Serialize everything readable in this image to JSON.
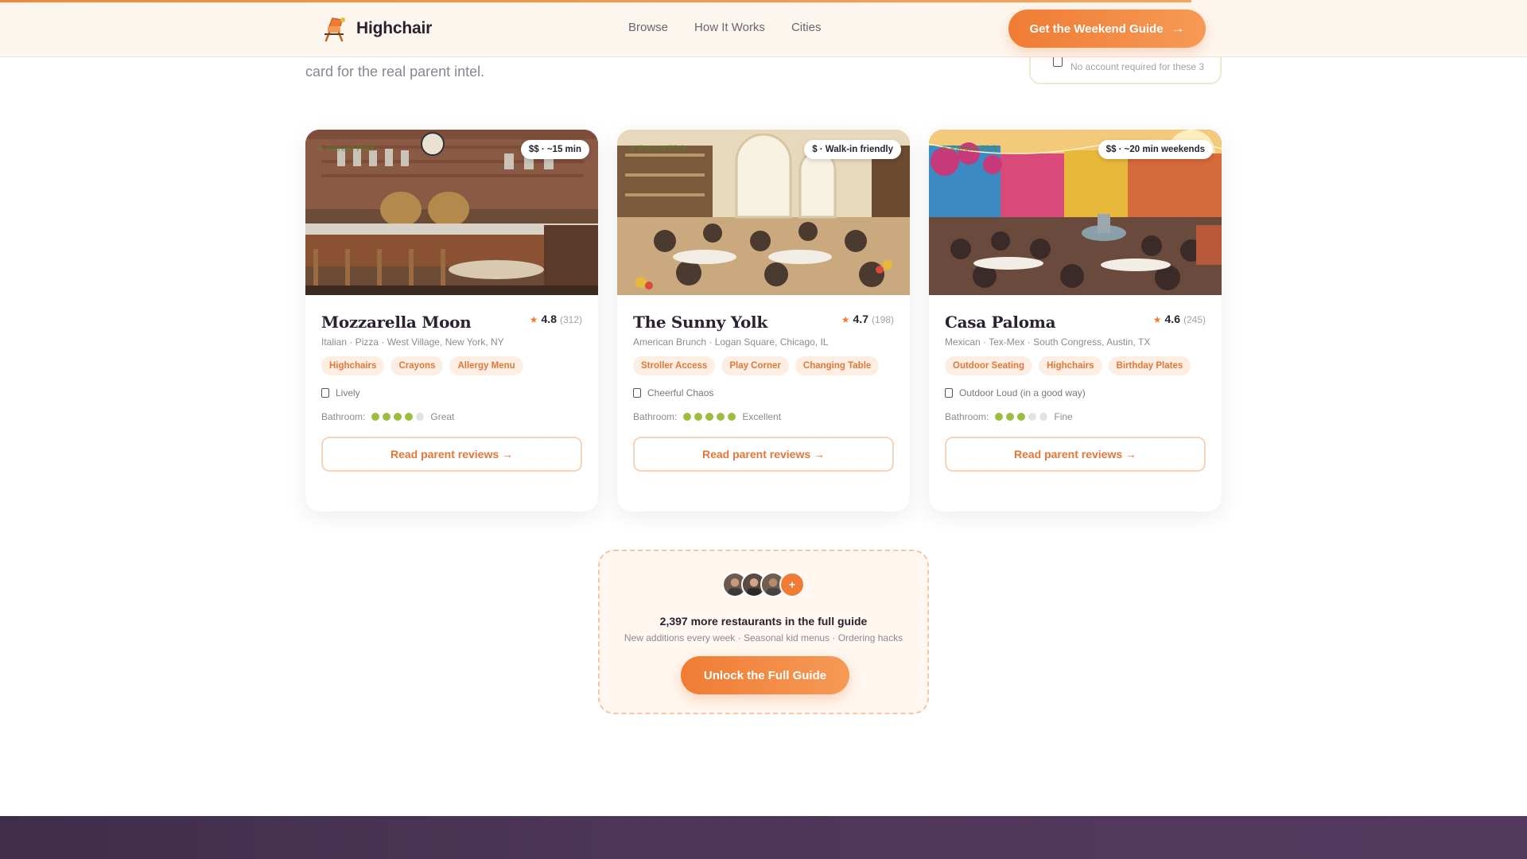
{
  "brand": {
    "name": "Highchair",
    "logo_icon": "highchair-logo-icon"
  },
  "nav": {
    "items": [
      "Browse",
      "How It Works",
      "Cities"
    ]
  },
  "header_cta": {
    "label": "Get the Weekend Guide",
    "arrow": "→"
  },
  "intro": {
    "text": "card for the real parent intel."
  },
  "note": {
    "text": "No account required for these 3",
    "icon": "lock-icon"
  },
  "cards": [
    {
      "name": "Mozzarella Moon",
      "rating": "4.8",
      "reviews": "(312)",
      "meta": "Italian · Pizza · West Village, New York, NY",
      "price": "$$ · ~15 min",
      "tags": [
        "Highchairs",
        "Crayons",
        "Allergy Menu"
      ],
      "vibe": "Lively",
      "bathroom_label": "Bathroom:",
      "bathroom_score": 4,
      "bathroom_text": "Great",
      "cta": "Read parent reviews →"
    },
    {
      "name": "The Sunny Yolk",
      "rating": "4.7",
      "reviews": "(198)",
      "meta": "American Brunch · Logan Square, Chicago, IL",
      "price": "$ · Walk-in friendly",
      "tags": [
        "Stroller Access",
        "Play Corner",
        "Changing Table"
      ],
      "vibe": "Cheerful Chaos",
      "bathroom_label": "Bathroom:",
      "bathroom_score": 5,
      "bathroom_text": "Excellent",
      "cta": "Read parent reviews →"
    },
    {
      "name": "Casa Paloma",
      "rating": "4.6",
      "reviews": "(245)",
      "meta": "Mexican · Tex-Mex · South Congress, Austin, TX",
      "price": "$$ · ~20 min weekends",
      "tags": [
        "Outdoor Seating",
        "Highchairs",
        "Birthday Plates"
      ],
      "vibe": "Outdoor Loud (in a good way)",
      "bathroom_label": "Bathroom:",
      "bathroom_score": 3,
      "bathroom_text": "Fine",
      "cta": "Read parent reviews →"
    }
  ],
  "unlock": {
    "title": "2,397 more restaurants in the full guide",
    "subtitle": "New additions every week · Seasonal kid menus · Ordering hacks",
    "button": "Unlock the Full Guide",
    "plus": "+"
  },
  "colors": {
    "accent": "#f07c34",
    "tag_bg": "#fdeee3",
    "rating_dot_on": "#9dbd3e",
    "footer": "#4d3658"
  }
}
